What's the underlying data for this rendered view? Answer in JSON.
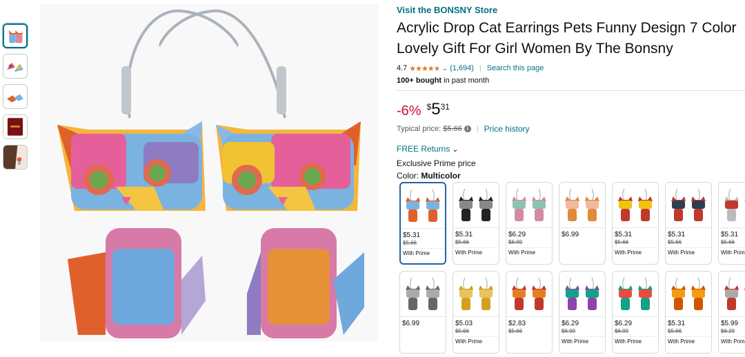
{
  "store_link": "Visit the BONSNY Store",
  "title": "Acrylic Drop Cat Earrings Pets Funny Design 7 Color Lovely Gift For Girl Women By The Bonsny",
  "rating": {
    "value": "4.7",
    "stars": 4.7,
    "count": "(1,694)",
    "search_link": "Search this page"
  },
  "bought": {
    "bold": "100+ bought",
    "rest": " in past month"
  },
  "price": {
    "discount": "-6%",
    "symbol": "$",
    "whole": "5",
    "fraction": "31",
    "typical_label": "Typical price:",
    "typical_value": "$5.66",
    "info_icon": "i",
    "history_link": "Price history"
  },
  "returns": {
    "label": "FREE Returns",
    "icon": "chevron-down-icon"
  },
  "exclusive": "Exclusive Prime price",
  "color": {
    "label": "Color: ",
    "value": "Multicolor"
  },
  "swatches": [
    {
      "price": "$5.31",
      "old": "$5.66",
      "prime": "With Prime",
      "c1": "#e0602c",
      "c2": "#7bb3e0",
      "selected": true
    },
    {
      "price": "$5.31",
      "old": "$5.66",
      "prime": "With Prime",
      "c1": "#222222",
      "c2": "#888888"
    },
    {
      "price": "$6.29",
      "old": "$6.99",
      "prime": "With Prime",
      "c1": "#d48aa0",
      "c2": "#8cc3b0"
    },
    {
      "price": "$6.99",
      "old": "",
      "prime": "",
      "c1": "#e08a3a",
      "c2": "#f2b8a0"
    },
    {
      "price": "$5.31",
      "old": "$5.66",
      "prime": "With Prime",
      "c1": "#c0392b",
      "c2": "#f1c40f"
    },
    {
      "price": "$5.31",
      "old": "$5.66",
      "prime": "With Prime",
      "c1": "#c0392b",
      "c2": "#2c3e50"
    },
    {
      "price": "$5.31",
      "old": "$5.66",
      "prime": "With Prime",
      "c1": "#bbbbbb",
      "c2": "#c0392b"
    },
    {
      "price": "$6.99",
      "old": "",
      "prime": "",
      "c1": "#666666",
      "c2": "#aaaaaa"
    },
    {
      "price": "$5.03",
      "old": "$5.66",
      "prime": "With Prime",
      "c1": "#d4a020",
      "c2": "#e6c35c"
    },
    {
      "price": "$2.83",
      "old": "$5.66",
      "prime": "",
      "c1": "#c0392b",
      "c2": "#e67e22"
    },
    {
      "price": "$6.29",
      "old": "$6.99",
      "prime": "With Prime",
      "c1": "#8e44ad",
      "c2": "#16a085"
    },
    {
      "price": "$6.29",
      "old": "$6.99",
      "prime": "With Prime",
      "c1": "#16a085",
      "c2": "#e74c3c"
    },
    {
      "price": "$5.31",
      "old": "$5.66",
      "prime": "With Prime",
      "c1": "#d35400",
      "c2": "#f39c12"
    },
    {
      "price": "$5.99",
      "old": "$6.29",
      "prime": "With Prime",
      "c1": "#c0392b",
      "c2": "#aaaaaa"
    }
  ]
}
